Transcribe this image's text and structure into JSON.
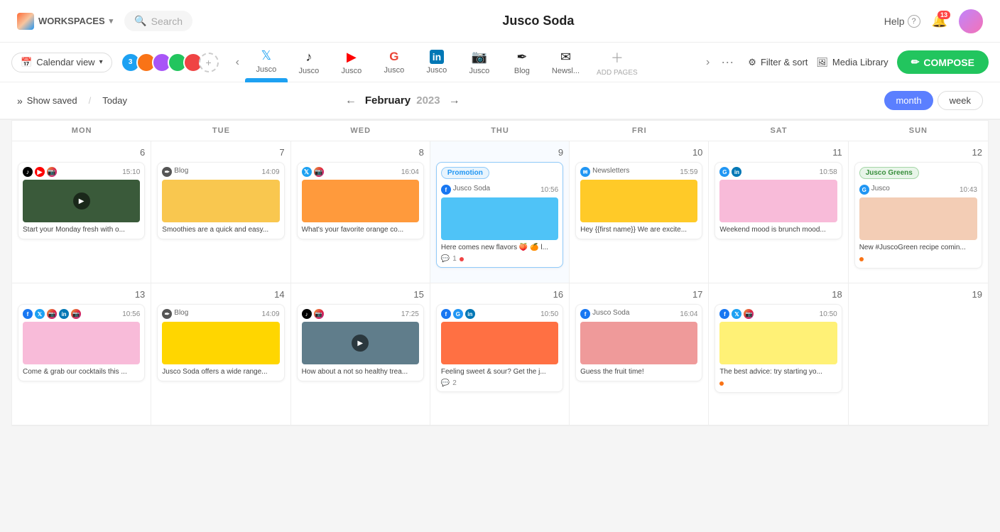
{
  "app": {
    "title": "Jusco Soda",
    "workspace_label": "WORKSPACES",
    "search_placeholder": "Search",
    "help_label": "Help",
    "notif_count": "13"
  },
  "toolbar": {
    "calendar_view": "Calendar view",
    "filter_sort": "Filter & sort",
    "media_library": "Media Library",
    "compose": "COMPOSE",
    "add_pages": "ADD PAGES",
    "more": "···"
  },
  "pages": [
    {
      "id": "twitter",
      "label": "Jusco",
      "icon": "𝕏",
      "active": true,
      "color": "#1DA1F2"
    },
    {
      "id": "tiktok",
      "label": "Jusco",
      "icon": "♪",
      "active": false,
      "color": "#000"
    },
    {
      "id": "youtube",
      "label": "Jusco",
      "icon": "▶",
      "active": false,
      "color": "#FF0000"
    },
    {
      "id": "google",
      "label": "Jusco",
      "icon": "G",
      "active": false,
      "color": "#EA4335"
    },
    {
      "id": "linkedin",
      "label": "Jusco",
      "icon": "in",
      "active": false,
      "color": "#0077B5"
    },
    {
      "id": "instagram",
      "label": "Jusco",
      "icon": "📷",
      "active": false,
      "color": "#bc1888"
    },
    {
      "id": "blog",
      "label": "Blog",
      "icon": "✒",
      "active": false,
      "color": "#555"
    },
    {
      "id": "newsletter",
      "label": "Newsl...",
      "icon": "✉",
      "active": false,
      "color": "#2196F3"
    }
  ],
  "calendar": {
    "show_saved": "Show saved",
    "today": "Today",
    "month": "February 2023",
    "month_label": "February",
    "year": "2023",
    "month_btn": "month",
    "week_btn": "week",
    "days": [
      "MON",
      "TUE",
      "WED",
      "THU",
      "FRI",
      "SAT",
      "SUN"
    ],
    "week1_nums": [
      6,
      7,
      8,
      9,
      10,
      11,
      12
    ],
    "week2_nums": [
      13,
      14,
      15,
      16,
      17,
      18,
      19
    ]
  },
  "posts": {
    "w1_mon": {
      "icons": [
        "tiktok",
        "youtube",
        "instagram"
      ],
      "time": "15:10",
      "text": "Start your Monday fresh with o...",
      "img_class": "img-citrus",
      "has_video": true
    },
    "w1_tue": {
      "tag": null,
      "sub_label": "Blog",
      "time": "14:09",
      "text": "Smoothies are a quick and easy...",
      "img_class": "img-smoothie"
    },
    "w1_wed": {
      "icons": [
        "twitter",
        "instagram"
      ],
      "time": "16:04",
      "text": "What's your favorite orange co...",
      "img_class": "img-orange"
    },
    "w1_thu": {
      "tag": "Promotion",
      "sub_label": "Jusco Soda",
      "sub_icon": "facebook",
      "time": "10:56",
      "text": "Here comes new flavors 🍑 🍊 l...",
      "img_class": "img-peach",
      "comments": 1,
      "has_dot": true
    },
    "w1_fri": {
      "tag": null,
      "sub_label": "Newsletters",
      "sub_icon": "newsletter",
      "time": "15:59",
      "text": "Hey {{first name}} We are excite...",
      "img_class": "img-mango"
    },
    "w1_sat": {
      "icons": [
        "g",
        "linkedin"
      ],
      "time": "10:58",
      "text": "Weekend mood is brunch mood...",
      "img_class": "img-brunch"
    },
    "w1_sun": {
      "tag": "Jusco Greens",
      "sub_label": "Jusco",
      "sub_icon": "g",
      "time": "10:43",
      "text": "New #JuscoGreen recipe comin...",
      "img_class": "img-fig",
      "has_dot_orange": true
    },
    "w2_mon": {
      "icons": [
        "facebook",
        "twitter",
        "instagram",
        "linkedin",
        "instagram2"
      ],
      "time": "10:56",
      "text": "Come & grab our cocktails this ...",
      "img_class": "img-grapefruit"
    },
    "w2_tue": {
      "tag": null,
      "sub_label": "Blog",
      "time": "14:09",
      "text": "Jusco Soda offers a wide range...",
      "img_class": "img-pineapple"
    },
    "w2_wed": {
      "icons": [
        "tiktok",
        "instagram"
      ],
      "time": "17:25",
      "text": "How about a not so healthy trea...",
      "img_class": "img-tiktok2",
      "has_video": true
    },
    "w2_thu": {
      "icons": [
        "facebook",
        "g",
        "linkedin"
      ],
      "time": "10:50",
      "text": "Feeling sweet & sour? Get the j...",
      "img_class": "img-orange2",
      "comments": 2
    },
    "w2_fri": {
      "sub_label": "Jusco Soda",
      "sub_icon": "facebook",
      "time": "16:04",
      "text": "Guess the fruit time!",
      "img_class": "img-fruit2"
    },
    "w2_sat": {
      "icons": [
        "facebook",
        "twitter",
        "instagram"
      ],
      "time": "10:50",
      "text": "The best advice: try starting yo...",
      "img_class": "img-lemon",
      "has_dot_orange": true
    }
  }
}
